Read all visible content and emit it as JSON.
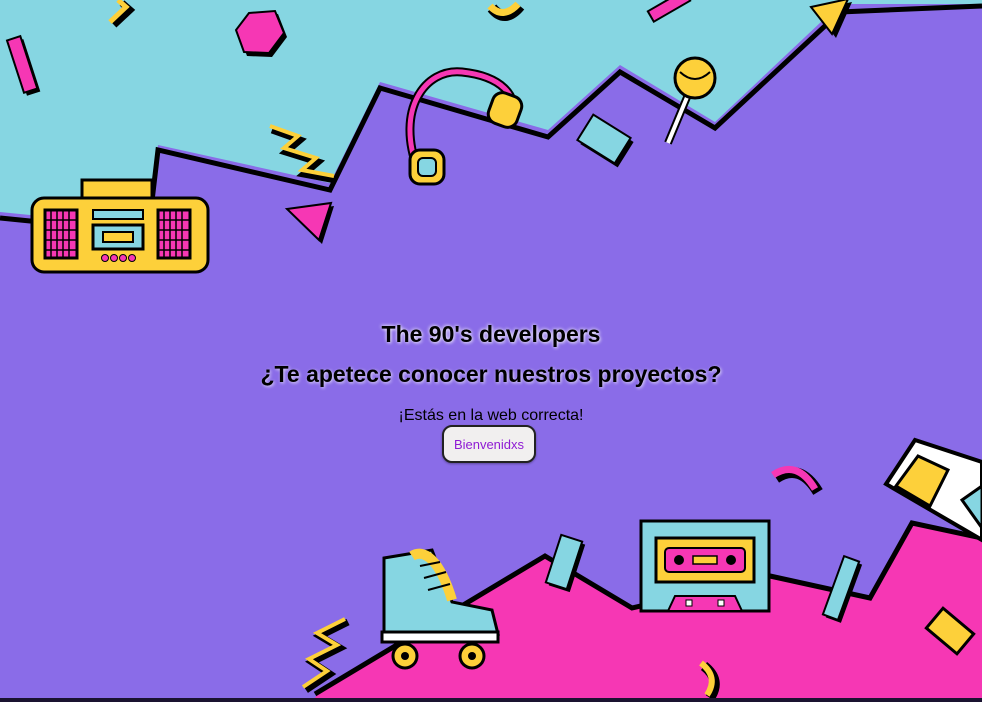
{
  "page": {
    "title": "The 90's developers",
    "subtitle": "¿Te apetece conocer nuestros proyectos?",
    "tagline": "¡Estás en la web correcta!",
    "welcome_button": "Bienvenidxs"
  },
  "colors": {
    "background": "#8a6ce8",
    "top_band": "#86d6e2",
    "bottom_band": "#f637b4",
    "accent_yellow": "#fdd03a",
    "accent_pink": "#f637b4",
    "button_text": "#8f1bd4"
  },
  "illustrations": [
    "boombox-icon",
    "headphones-icon",
    "lollipop-icon",
    "cassette-tape-icon",
    "roller-skate-icon",
    "3d-glasses-icon",
    "hexagon-shape",
    "triangle-shape",
    "zigzag-shape"
  ]
}
